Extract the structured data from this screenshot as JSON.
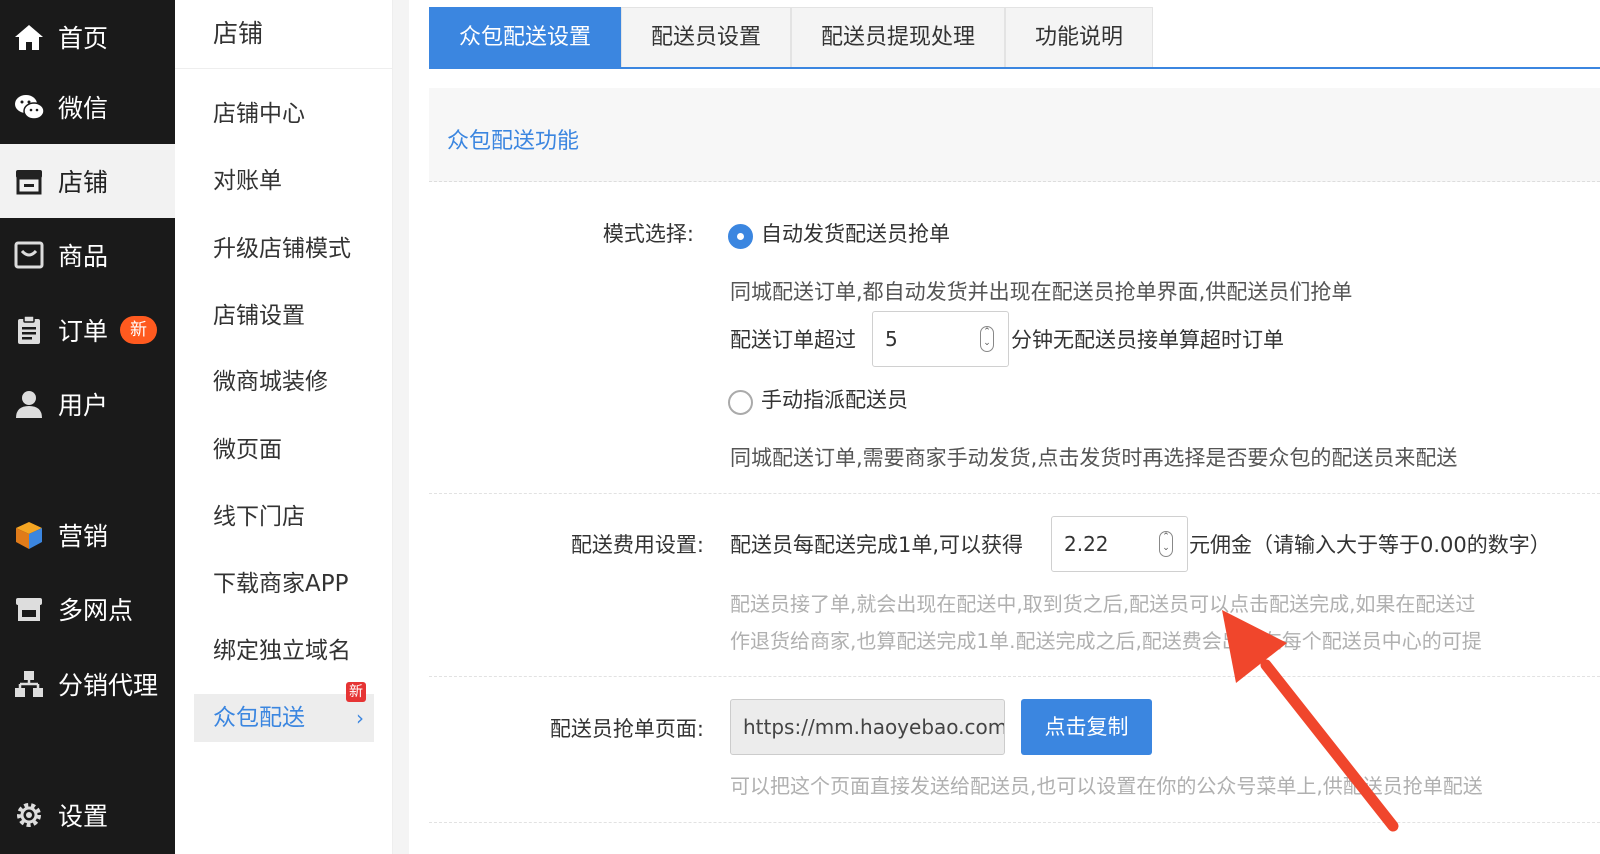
{
  "sidebar": {
    "items": [
      {
        "label": "首页",
        "icon": "home-icon"
      },
      {
        "label": "微信",
        "icon": "wechat-icon"
      },
      {
        "label": "店铺",
        "icon": "store-icon"
      },
      {
        "label": "商品",
        "icon": "box-icon"
      },
      {
        "label": "订单",
        "icon": "clipboard-icon",
        "badge": "新"
      },
      {
        "label": "用户",
        "icon": "user-icon"
      },
      {
        "label": "营销",
        "icon": "cube-icon"
      },
      {
        "label": "多网点",
        "icon": "branch-store-icon"
      },
      {
        "label": "分销代理",
        "icon": "hierarchy-icon"
      },
      {
        "label": "设置",
        "icon": "gear-icon"
      }
    ]
  },
  "submenu": {
    "title": "店铺",
    "items": [
      {
        "label": "店铺中心"
      },
      {
        "label": "对账单"
      },
      {
        "label": "升级店铺模式"
      },
      {
        "label": "店铺设置"
      },
      {
        "label": "微商城装修"
      },
      {
        "label": "微页面"
      },
      {
        "label": "线下门店"
      },
      {
        "label": "下载商家APP"
      },
      {
        "label": "绑定独立域名"
      },
      {
        "label": "众包配送",
        "badge": "新"
      }
    ]
  },
  "tabs": [
    {
      "label": "众包配送设置"
    },
    {
      "label": "配送员设置"
    },
    {
      "label": "配送员提现处理"
    },
    {
      "label": "功能说明"
    }
  ],
  "section": {
    "title": "众包配送功能"
  },
  "mode": {
    "label": "模式选择:",
    "auto_label": "自动发货配送员抢单",
    "auto_desc": "同城配送订单,都自动发货并出现在配送员抢单界面,供配送员们抢单",
    "timeout_prefix": "配送订单超过",
    "timeout_value": "5",
    "timeout_suffix": "分钟无配送员接单算超时订单",
    "manual_label": "手动指派配送员",
    "manual_desc": "同城配送订单,需要商家手动发货,点击发货时再选择是否要众包的配送员来配送"
  },
  "fee": {
    "label": "配送费用设置:",
    "prefix": "配送员每配送完成1单,可以获得",
    "value": "2.22",
    "suffix": "元佣金（请输入大于等于0.00的数字）",
    "hint1": "配送员接了单,就会出现在配送中,取到货之后,配送员可以点击配送完成,如果在配送过",
    "hint2": "作退货给商家,也算配送完成1单.配送完成之后,配送费会出现在每个配送员中心的可提"
  },
  "page": {
    "label": "配送员抢单页面:",
    "url": "https://mm.haoyebao.com",
    "copy_label": "点击复制",
    "hint": "可以把这个页面直接发送给配送员,也可以设置在你的公众号菜单上,供配送员抢单配送"
  },
  "colors": {
    "accent": "#3b86e0",
    "sidebar_bg": "#1a1a1a",
    "badge": "#ff5a1f",
    "arrow": "#f0462c"
  }
}
